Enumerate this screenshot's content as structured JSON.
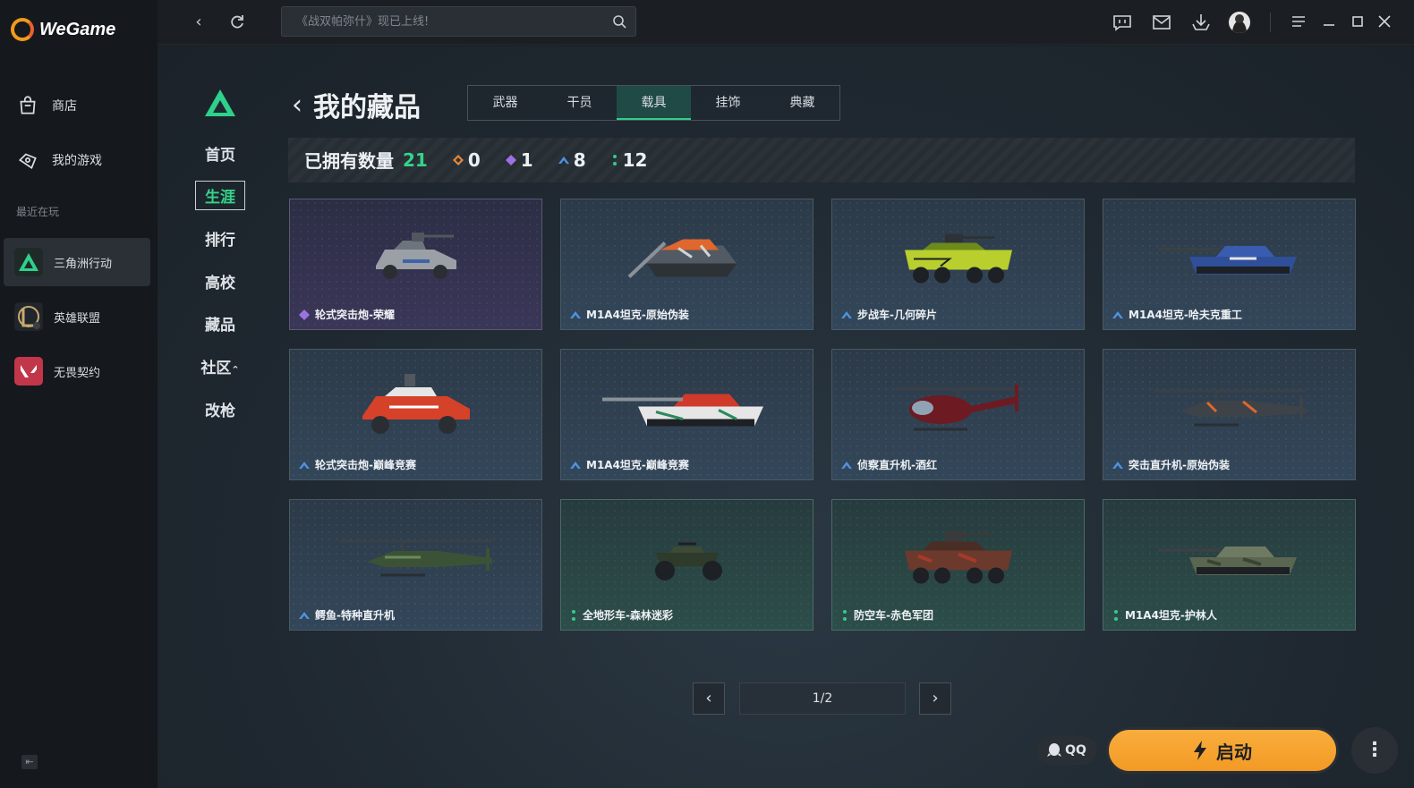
{
  "app": {
    "name": "WeGame"
  },
  "sidebar": {
    "items": [
      {
        "label": "商店",
        "icon": "store-bag-icon"
      },
      {
        "label": "我的游戏",
        "icon": "gamepad-icon"
      }
    ],
    "recent_label": "最近在玩",
    "games": [
      {
        "label": "三角洲行动",
        "icon": "delta-force-icon",
        "active": true
      },
      {
        "label": "英雄联盟",
        "icon": "league-of-legends-icon",
        "active": false
      },
      {
        "label": "无畏契约",
        "icon": "valorant-icon",
        "active": false
      }
    ]
  },
  "topbar": {
    "search_placeholder": "《战双帕弥什》现已上线!"
  },
  "game_nav": {
    "items": [
      "首页",
      "生涯",
      "排行",
      "高校",
      "藏品",
      "社区",
      "改枪"
    ],
    "active": "生涯"
  },
  "page": {
    "title": "我的藏品",
    "tabs": [
      "武器",
      "干员",
      "载具",
      "挂饰",
      "典藏"
    ],
    "active_tab": "载具",
    "owned_label": "已拥有数量",
    "owned_count": "21",
    "rarity_counts": [
      {
        "value": "0",
        "color": "#e8883a"
      },
      {
        "value": "1",
        "color": "#9b73e0"
      },
      {
        "value": "8",
        "color": "#4f92e0"
      },
      {
        "value": "12",
        "color": "#36c98a"
      }
    ]
  },
  "items": [
    {
      "name": "轮式突击炮-荣耀",
      "rarity": "purple",
      "art": "armored-car"
    },
    {
      "name": "M1A4坦克-原始伪装",
      "rarity": "blue",
      "art": "tank-orange"
    },
    {
      "name": "步战车-几何碎片",
      "rarity": "blue",
      "art": "ifv-yellow"
    },
    {
      "name": "M1A4坦克-哈夫克重工",
      "rarity": "blue",
      "art": "tank-blue"
    },
    {
      "name": "轮式突击炮-巅峰竞赛",
      "rarity": "blue",
      "art": "armored-car-red"
    },
    {
      "name": "M1A4坦克-巅峰竞赛",
      "rarity": "blue",
      "art": "tank-red"
    },
    {
      "name": "侦察直升机-酒红",
      "rarity": "blue",
      "art": "scout-heli"
    },
    {
      "name": "突击直升机-原始伪装",
      "rarity": "blue",
      "art": "attack-heli"
    },
    {
      "name": "鳄鱼-特种直升机",
      "rarity": "blue",
      "art": "attack-heli-green"
    },
    {
      "name": "全地形车-森林迷彩",
      "rarity": "green",
      "art": "atv"
    },
    {
      "name": "防空车-赤色军团",
      "rarity": "green",
      "art": "ifv-camo"
    },
    {
      "name": "M1A4坦克-护林人",
      "rarity": "green",
      "art": "tank-camo"
    }
  ],
  "pagination": {
    "indicator": "1/2"
  },
  "launch": {
    "qq_label": "QQ",
    "start_label": "启动"
  }
}
